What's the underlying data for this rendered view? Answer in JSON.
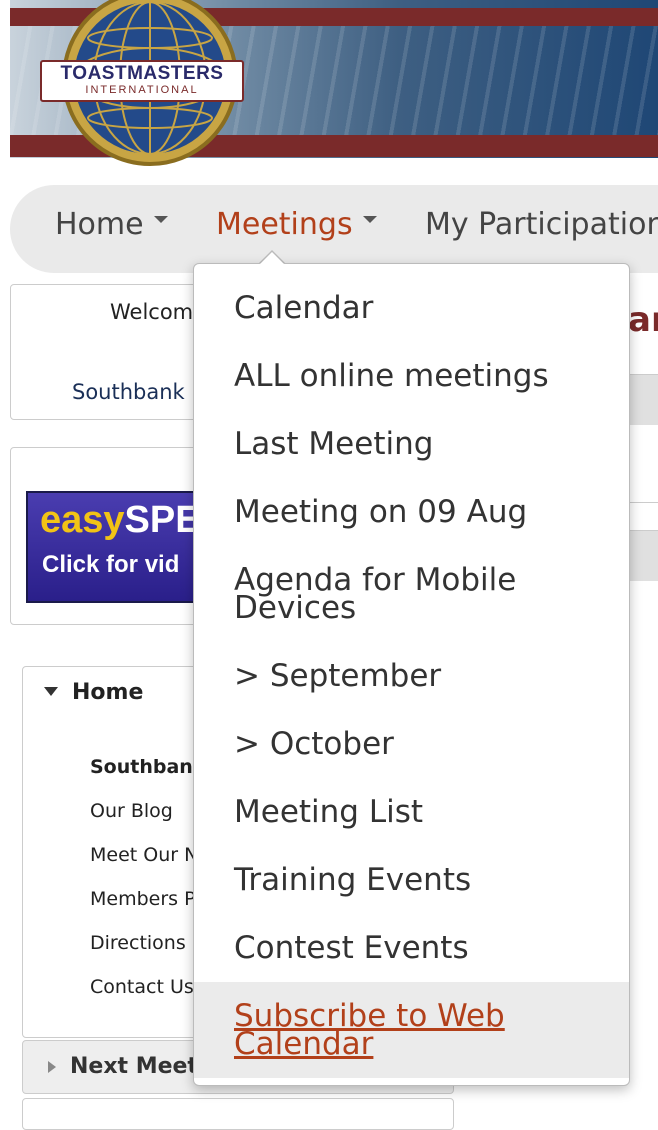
{
  "header": {
    "logo_title": "TOASTMASTERS",
    "logo_subtitle": "INTERNATIONAL",
    "logo_mark": "®"
  },
  "nav": {
    "items": [
      {
        "label": "Home"
      },
      {
        "label": "Meetings"
      },
      {
        "label": "My Participation"
      }
    ]
  },
  "dropdown": {
    "items": [
      {
        "label": "Calendar"
      },
      {
        "label": "ALL online meetings"
      },
      {
        "label": "Last Meeting"
      },
      {
        "label": "Meeting on 09 Aug"
      },
      {
        "label": "Agenda for Mobile Devices"
      },
      {
        "label": "> September"
      },
      {
        "label": "> October"
      },
      {
        "label": "Meeting List"
      },
      {
        "label": "Training Events"
      },
      {
        "label": "Contest Events"
      },
      {
        "label": "Subscribe to Web Calendar"
      }
    ]
  },
  "welcome": {
    "text": "Welcom",
    "club_link": "Southbank"
  },
  "promo": {
    "brand_easy": "easy",
    "brand_spe": "SPE",
    "click_text": "Click for vid"
  },
  "sidebar": {
    "home_heading": "Home",
    "links": [
      {
        "label": "Southban"
      },
      {
        "label": "Our Blog"
      },
      {
        "label": "Meet Our N"
      },
      {
        "label": "Members P"
      },
      {
        "label": "Directions"
      },
      {
        "label": "Contact Us"
      }
    ],
    "next_heading": "Next Meet"
  },
  "right": {
    "title_fragment": "ar"
  },
  "colors": {
    "accent": "#b2401a",
    "banner_red": "#7a2a2a",
    "nav_bg": "#eaeaea",
    "link_navy": "#1a2f57"
  }
}
